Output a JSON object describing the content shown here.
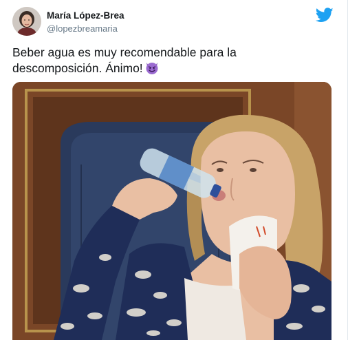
{
  "tweet": {
    "author_name": "María López-Brea",
    "author_handle": "@lopezbreamaria",
    "text_line1": "Beber agua es muy recomendable para la",
    "text_line2": "descomposición. Ánimo!",
    "emoji": "smiling-imp-emoji"
  },
  "icons": {
    "brand": "twitter-bird-icon",
    "brand_color": "#1da1f2"
  },
  "media": {
    "description_icon": "photo"
  }
}
